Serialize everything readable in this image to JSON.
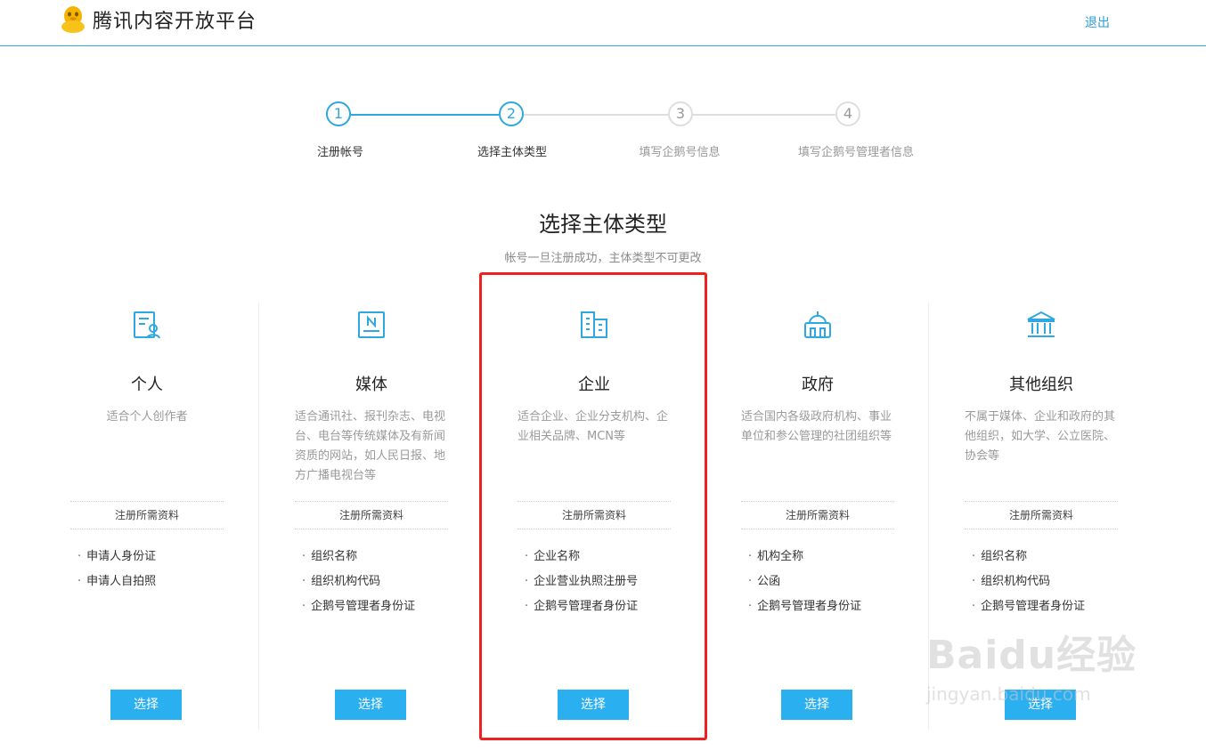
{
  "header": {
    "logo_text": "腾讯内容开放平台",
    "logout_label": "退出"
  },
  "stepper": {
    "steps": [
      {
        "number": "1",
        "label": "注册帐号",
        "state": "done"
      },
      {
        "number": "2",
        "label": "选择主体类型",
        "state": "current"
      },
      {
        "number": "3",
        "label": "填写企鹅号信息",
        "state": "todo"
      },
      {
        "number": "4",
        "label": "填写企鹅号管理者信息",
        "state": "todo"
      }
    ]
  },
  "heading": {
    "title": "选择主体类型",
    "subtitle": "帐号一旦注册成功，主体类型不可更改"
  },
  "entity_types": [
    {
      "name": "个人",
      "icon": "person-card-icon",
      "description": "适合个人创作者",
      "requirements_label": "注册所需资料",
      "requirements": [
        "申请人身份证",
        "申请人自拍照"
      ],
      "button_label": "选择"
    },
    {
      "name": "媒体",
      "icon": "newspaper-icon",
      "description": "适合通讯社、报刊杂志、电视台、电台等传统媒体及有新闻资质的网站，如人民日报、地方广播电视台等",
      "requirements_label": "注册所需资料",
      "requirements": [
        "组织名称",
        "组织机构代码",
        "企鹅号管理者身份证"
      ],
      "button_label": "选择"
    },
    {
      "name": "企业",
      "icon": "building-icon",
      "description": "适合企业、企业分支机构、企业相关品牌、MCN等",
      "requirements_label": "注册所需资料",
      "requirements": [
        "企业名称",
        "企业营业执照注册号",
        "企鹅号管理者身份证"
      ],
      "button_label": "选择",
      "highlighted": true
    },
    {
      "name": "政府",
      "icon": "government-building-icon",
      "description": "适合国内各级政府机构、事业单位和参公管理的社团组织等",
      "requirements_label": "注册所需资料",
      "requirements": [
        "机构全称",
        "公函",
        "企鹅号管理者身份证"
      ],
      "button_label": "选择"
    },
    {
      "name": "其他组织",
      "icon": "institution-icon",
      "description": "不属于媒体、企业和政府的其他组织，如大学、公立医院、协会等",
      "requirements_label": "注册所需资料",
      "requirements": [
        "组织名称",
        "组织机构代码",
        "企鹅号管理者身份证"
      ],
      "button_label": "选择"
    }
  ],
  "watermark": {
    "main": "Baidu经验",
    "sub": "jingyan.baidu.com"
  },
  "colors": {
    "accent": "#2fa7e0",
    "button": "#2aaff0",
    "highlight": "#f02020"
  }
}
